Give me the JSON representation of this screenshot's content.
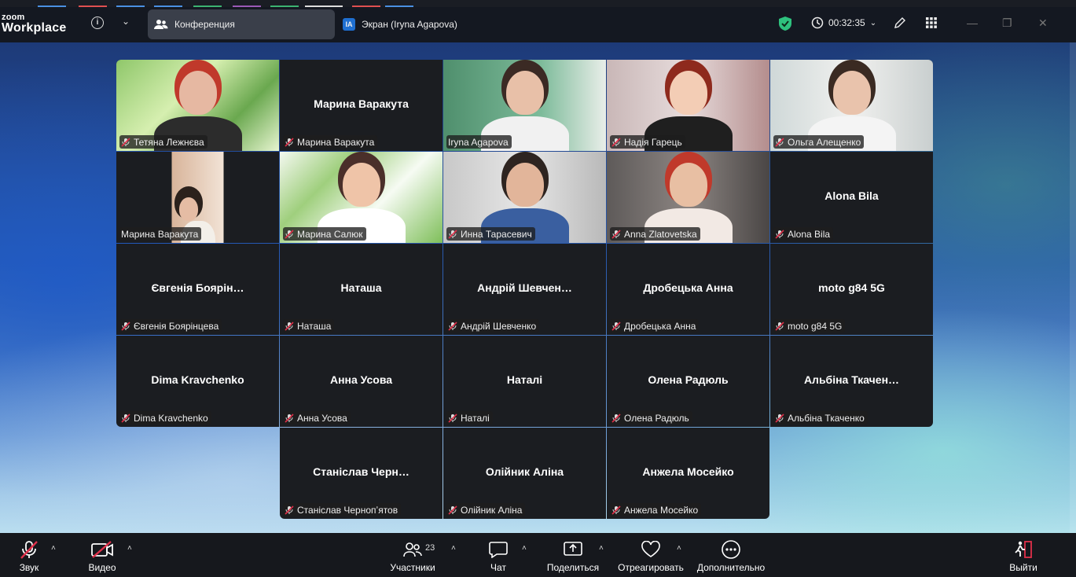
{
  "app": {
    "logo_line1": "zoom",
    "logo_line2": "Workplace"
  },
  "tabs": [
    {
      "label": "Конференция"
    },
    {
      "label": "Экран (Iryna Agapova)",
      "badge": "IA"
    }
  ],
  "timer": "00:32:35",
  "colors": {
    "active_speaker": "#2ec27e",
    "muted": "#e0304a",
    "accent": "#1f6fd1"
  },
  "participants": [
    {
      "name": "Тетяна Лежнєва",
      "label": "Тетяна Лежнєва",
      "video": true
    },
    {
      "name": "Марина Варакута",
      "label": "Марина Варакута",
      "video": false
    },
    {
      "name": "Iryna Agapova",
      "label": "Iryna Agapova",
      "video": true,
      "active": true,
      "mic": "on"
    },
    {
      "name": "Надія Гарець",
      "label": "Надія Гарець",
      "video": true
    },
    {
      "name": "Ольга Алещенко",
      "label": "Ольга Алещенко",
      "video": true
    },
    {
      "name": "Марина Варакута",
      "label": "Марина Варакута",
      "video": true,
      "mic": "none"
    },
    {
      "name": "Марина Салюк",
      "label": "Марина Салюк",
      "video": true
    },
    {
      "name": "Инна Тарасевич",
      "label": "Инна Тарасевич",
      "video": true
    },
    {
      "name": "Anna Zlatovetska",
      "label": "Anna Zlatovetska",
      "video": true
    },
    {
      "name": "Alona Bila",
      "label": "Alona Bila",
      "video": false
    },
    {
      "name": "Євгенія Боярінцева",
      "label": "Євгенія Боярін…",
      "video": false
    },
    {
      "name": "Наташа",
      "label": "Наташа",
      "video": false
    },
    {
      "name": "Андрій Шевченко",
      "label": "Андрій Шевчен…",
      "video": false
    },
    {
      "name": "Дробецька Анна",
      "label": "Дробецька Анна",
      "video": false
    },
    {
      "name": "moto g84 5G",
      "label": "moto g84 5G",
      "video": false
    },
    {
      "name": "Dima Kravchenko",
      "label": "Dima Kravchenko",
      "video": false
    },
    {
      "name": "Анна Усова",
      "label": "Анна Усова",
      "video": false
    },
    {
      "name": "Наталі",
      "label": "Наталі",
      "video": false
    },
    {
      "name": "Олена Радюль",
      "label": "Олена Радюль",
      "video": false
    },
    {
      "name": "Альбіна Ткаченко",
      "label": "Альбіна Ткачен…",
      "video": false
    },
    {
      "name": "Станіслав Чернопʼятов",
      "label": "Станіслав Черн…",
      "video": false
    },
    {
      "name": "Олійник Аліна",
      "label": "Олійник Аліна",
      "video": false
    },
    {
      "name": "Анжела Мосейко",
      "label": "Анжела Мосейко",
      "video": false
    }
  ],
  "toolbar": {
    "audio": "Звук",
    "video": "Видео",
    "participants": "Участники",
    "participants_count": "23",
    "chat": "Чат",
    "share": "Поделиться",
    "react": "Отреагировать",
    "more": "Дополнительно",
    "leave": "Выйти"
  }
}
